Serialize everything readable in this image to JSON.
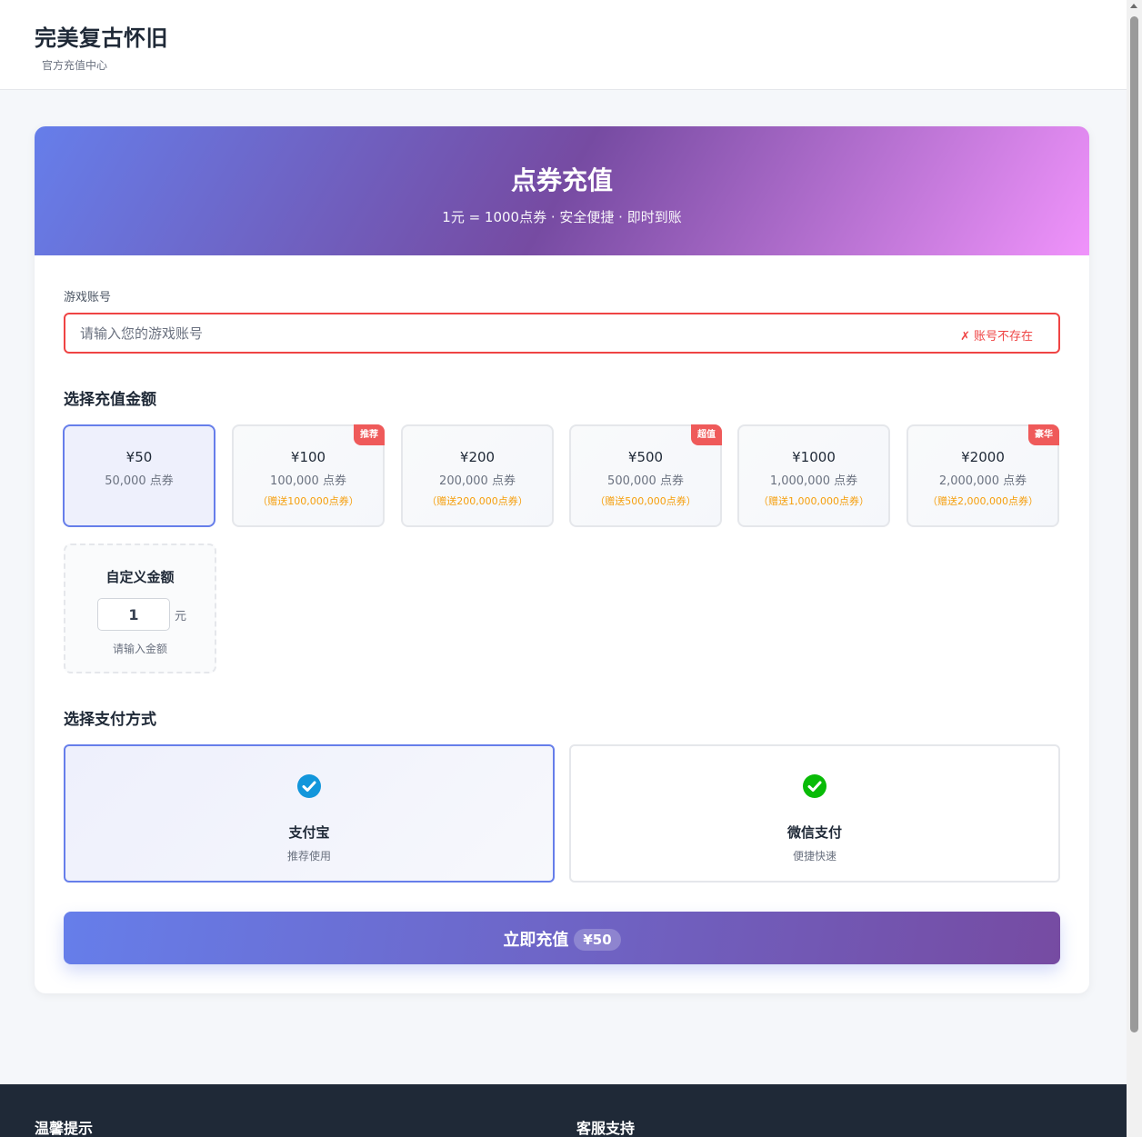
{
  "header": {
    "title": "完美复古怀旧",
    "subtitle": "官方充值中心"
  },
  "banner": {
    "title": "点券充值",
    "subtitle": "1元 = 1000点券 · 安全便捷 · 即时到账"
  },
  "account": {
    "label": "游戏账号",
    "placeholder": "请输入您的游戏账号",
    "value": "",
    "error_icon": "✗",
    "error_text": "账号不存在"
  },
  "amount_section": {
    "title": "选择充值金额",
    "options": [
      {
        "price": "¥50",
        "points": "50,000 点券",
        "bonus": "",
        "tag": "",
        "selected": true
      },
      {
        "price": "¥100",
        "points": "100,000 点券",
        "bonus": "（赠送100,000点券）",
        "tag": "推荐",
        "selected": false
      },
      {
        "price": "¥200",
        "points": "200,000 点券",
        "bonus": "（赠送200,000点券）",
        "tag": "",
        "selected": false
      },
      {
        "price": "¥500",
        "points": "500,000 点券",
        "bonus": "（赠送500,000点券）",
        "tag": "超值",
        "selected": false
      },
      {
        "price": "¥1000",
        "points": "1,000,000 点券",
        "bonus": "（赠送1,000,000点券）",
        "tag": "",
        "selected": false
      },
      {
        "price": "¥2000",
        "points": "2,000,000 点券",
        "bonus": "（赠送2,000,000点券）",
        "tag": "豪华",
        "selected": false
      }
    ],
    "custom": {
      "title": "自定义金额",
      "value": "1",
      "unit": "元",
      "hint": "请输入金额"
    }
  },
  "payment_section": {
    "title": "选择支付方式",
    "methods": [
      {
        "name": "支付宝",
        "desc": "推荐使用",
        "icon": "alipay-check-icon",
        "color": "#1296db",
        "selected": true
      },
      {
        "name": "微信支付",
        "desc": "便捷快速",
        "icon": "wechat-check-icon",
        "color": "#09bb07",
        "selected": false
      }
    ]
  },
  "submit": {
    "label": "立即充值",
    "amount": "¥50"
  },
  "footer": {
    "col1_title": "温馨提示",
    "col2_title": "客服支持"
  },
  "colors": {
    "accent": "#667eea",
    "accent_dark": "#764ba2",
    "error": "#ef4444",
    "bonus": "#f59e0b",
    "tag": "#ef5a5a",
    "footer_bg": "#1f2937"
  }
}
